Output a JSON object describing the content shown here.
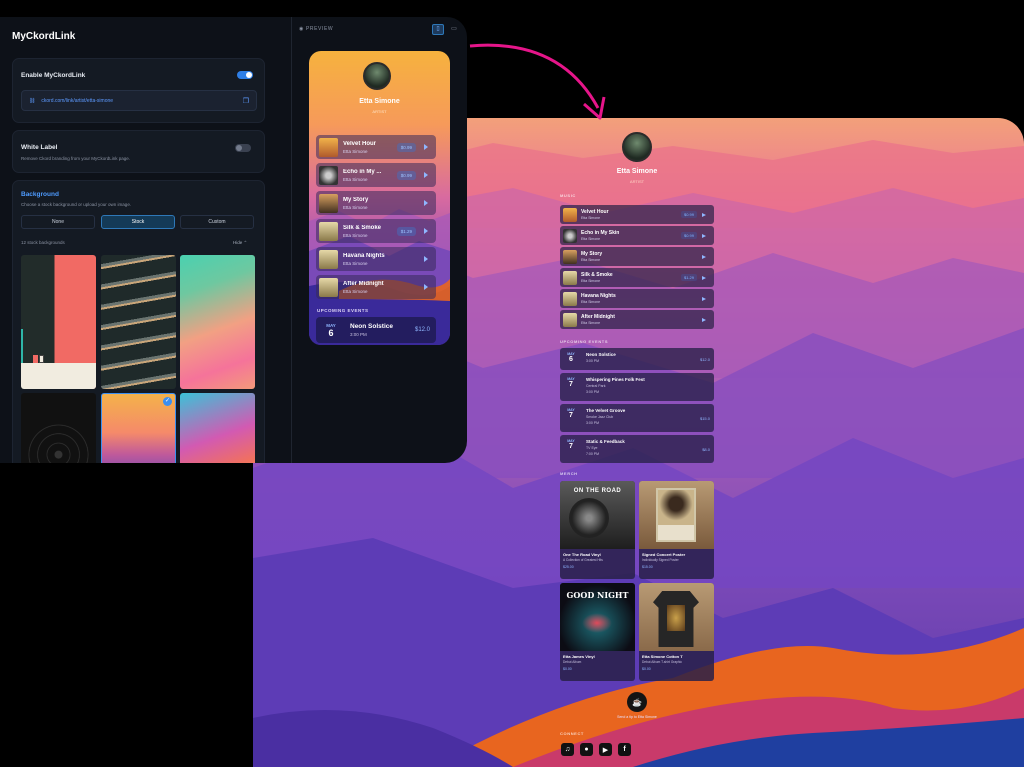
{
  "editor": {
    "app_title": "MyCkordLink",
    "enable": {
      "label": "Enable MyCkordLink",
      "url": "ckord.com/link/artist/etta-simone",
      "on": true
    },
    "white_label": {
      "title": "White Label",
      "description": "Remove Ckord branding from your MyCkordLink page.",
      "on": false
    },
    "background": {
      "title": "Background",
      "description": "Choose a stock background or upload your own image.",
      "options": [
        "None",
        "Stock",
        "Custom"
      ],
      "selected": "Stock",
      "count_label": "12 stock backgrounds",
      "hide_label": "Hide"
    },
    "preview_label": "PREVIEW"
  },
  "phone": {
    "artist": "Etta Simone",
    "subtitle": "ARTIST",
    "tracks": [
      {
        "title": "Velvet Hour",
        "artist": "Etta Simone",
        "price": "$0.99"
      },
      {
        "title": "Echo in My ...",
        "artist": "Etta Simone",
        "price": "$0.99"
      },
      {
        "title": "My Story",
        "artist": "Etta Simone",
        "price": ""
      },
      {
        "title": "Silk & Smoke",
        "artist": "Etta Simone",
        "price": "$1.29"
      },
      {
        "title": "Havana Nights",
        "artist": "Etta Simone",
        "price": ""
      },
      {
        "title": "After Midnight",
        "artist": "Etta Simone",
        "price": ""
      }
    ],
    "events_label": "UPCOMING EVENTS",
    "event": {
      "month": "MAY",
      "day": "6",
      "title": "Neon Solstice",
      "time": "3:00 PM",
      "price": "$12.0"
    }
  },
  "page": {
    "artist": "Etta Simone",
    "subtitle": "ARTIST",
    "music_label": "MUSIC",
    "tracks": [
      {
        "title": "Velvet Hour",
        "artist": "Etta Simone",
        "price": "$0.99"
      },
      {
        "title": "Echo in My Skin",
        "artist": "Etta Simone",
        "price": "$0.99"
      },
      {
        "title": "My Story",
        "artist": "Etta Simone",
        "price": ""
      },
      {
        "title": "Silk & Smoke",
        "artist": "Etta Simone",
        "price": "$1.29"
      },
      {
        "title": "Havana Nights",
        "artist": "Etta Simone",
        "price": ""
      },
      {
        "title": "After Midnight",
        "artist": "Etta Simone",
        "price": ""
      }
    ],
    "events_label": "UPCOMING EVENTS",
    "events": [
      {
        "month": "MAY",
        "day": "6",
        "title": "Neon Solstice",
        "venue": "",
        "time": "3:00 PM",
        "price": "$12.0"
      },
      {
        "month": "MAY",
        "day": "7",
        "title": "Whispering Pines Folk Fest",
        "venue": "Central Park",
        "time": "3:00 PM",
        "price": ""
      },
      {
        "month": "MAY",
        "day": "7",
        "title": "The Velvet Groove",
        "venue": "Smoke Jazz Club",
        "time": "3:00 PM",
        "price": "$15.0"
      },
      {
        "month": "MAY",
        "day": "7",
        "title": "Static & Feedback",
        "venue": "TV Eye",
        "time": "7:00 PM",
        "price": "$8.0"
      }
    ],
    "merch_label": "MERCH",
    "merch": [
      {
        "title": "One The Road Vinyl",
        "desc": "A Collection of Greatest Hits",
        "price": "$25.00",
        "art": "ON THE ROAD"
      },
      {
        "title": "Signed Concert Poster",
        "desc": "Individually Signed Poster",
        "price": "$15.00",
        "art": ""
      },
      {
        "title": "Etta James Vinyl",
        "desc": "Debut Album",
        "price": "$0.00",
        "art": "GOOD NIGHT"
      },
      {
        "title": "Etta Simone Cotton T",
        "desc": "Debut Album T-shirt Graphic",
        "price": "$0.00",
        "art": ""
      }
    ],
    "tip_label": "Send a tip to Etta Simone",
    "connect_label": "CONNECT"
  }
}
